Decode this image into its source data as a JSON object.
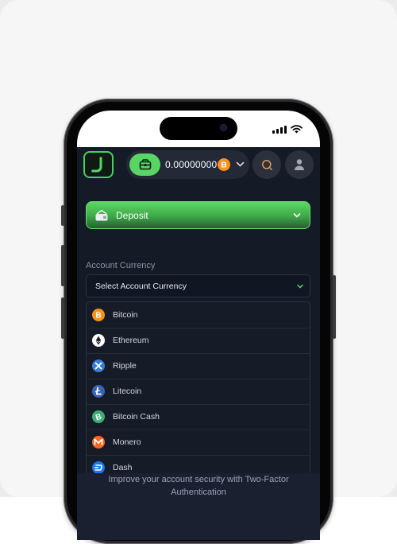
{
  "header": {
    "balance": "0.00000000"
  },
  "deposit": {
    "label": "Deposit"
  },
  "account_currency": {
    "label": "Account Currency",
    "select_placeholder": "Select Account Currency",
    "options": [
      {
        "label": "Bitcoin",
        "icon": "bitcoin-icon",
        "color": "#f7931a"
      },
      {
        "label": "Ethereum",
        "icon": "ethereum-icon",
        "color": "#ffffff"
      },
      {
        "label": "Ripple",
        "icon": "ripple-icon",
        "color": "#3c7bd4"
      },
      {
        "label": "Litecoin",
        "icon": "litecoin-icon",
        "color": "#3a63b0"
      },
      {
        "label": "Bitcoin Cash",
        "icon": "bitcoin-cash-icon",
        "color": "#3fae74"
      },
      {
        "label": "Monero",
        "icon": "monero-icon",
        "color": "#f26822"
      },
      {
        "label": "Dash",
        "icon": "dash-icon",
        "color": "#1c75e8"
      }
    ]
  },
  "twofa": {
    "text": "Improve your account security with Two-Factor Authentication"
  },
  "colors": {
    "accent_green": "#58d565",
    "app_background": "#141a26"
  }
}
